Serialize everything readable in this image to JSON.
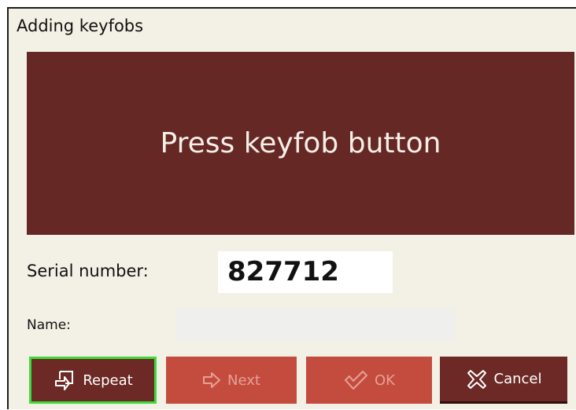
{
  "dialog": {
    "title": "Adding keyfobs",
    "prompt": "Press keyfob button"
  },
  "serial": {
    "label": "Serial number:",
    "value": "827712"
  },
  "name": {
    "label": "Name:",
    "value": ""
  },
  "buttons": {
    "repeat": {
      "label": "Repeat",
      "icon": "repeat-icon",
      "enabled": true
    },
    "next": {
      "label": "Next",
      "icon": "arrow-right-icon",
      "enabled": false
    },
    "ok": {
      "label": "OK",
      "icon": "check-icon",
      "enabled": false
    },
    "cancel": {
      "label": "Cancel",
      "icon": "cancel-x-icon",
      "enabled": true
    }
  },
  "colors": {
    "banner": "#662825",
    "dialog_bg": "#f3f1e5",
    "button_active": "#6d2925",
    "button_disabled": "#c44c3e",
    "focus_border": "#3ddb3b"
  }
}
